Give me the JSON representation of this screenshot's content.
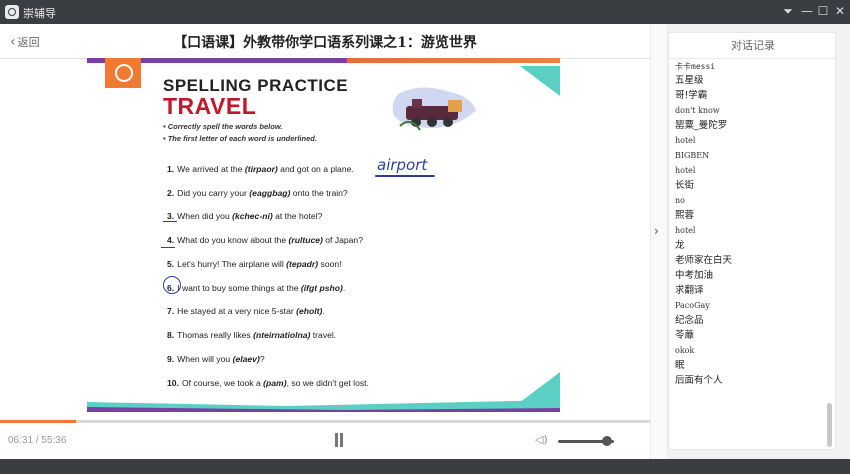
{
  "window": {
    "app_name": "崇辅导",
    "controls": [
      "⏷",
      "—",
      "☐",
      "✕"
    ]
  },
  "header": {
    "back_label": "返回",
    "lesson_title": "【口语课】外教带你学口语系列课之1：游览世界"
  },
  "slide": {
    "heading_line1": "SPELLING PRACTICE",
    "heading_line2": "TRAVEL",
    "notes": [
      "Correctly spell the words below.",
      "The first letter of each word is underlined."
    ],
    "questions": [
      {
        "num": "1.",
        "before": "We arrived at the ",
        "jumble": "(tirpaor)",
        "after": " and got on a plane."
      },
      {
        "num": "2.",
        "before": "Did you carry your ",
        "jumble": "(eaggbag)",
        "after": " onto the train?"
      },
      {
        "num": "3.",
        "before": "When did you ",
        "jumble": "(kchec-ni)",
        "after": " at the hotel?"
      },
      {
        "num": "4.",
        "before": "What do you know about the ",
        "jumble": "(rultuce)",
        "after": " of Japan?"
      },
      {
        "num": "5.",
        "before": "Let's hurry!  The airplane will ",
        "jumble": "(tepadr)",
        "after": " soon!"
      },
      {
        "num": "6.",
        "before": "I want to buy some things at the ",
        "jumble": "(ifgt psho)",
        "after": "."
      },
      {
        "num": "7.",
        "before": "He stayed at a very nice 5-star ",
        "jumble": "(eholt)",
        "after": "."
      },
      {
        "num": "8.",
        "before": "Thomas really likes ",
        "jumble": "(nteirnatiolna)",
        "after": " travel."
      },
      {
        "num": "9.",
        "before": "When will you ",
        "jumble": "(elaev)",
        "after": "?"
      },
      {
        "num": "10.",
        "before": "Of course, we took a ",
        "jumble": "(pam)",
        "after": ", so we didn't get lost."
      }
    ],
    "handwritten_answer": "airport"
  },
  "player": {
    "time": "06:31 / 55:36",
    "progress": 0.117,
    "volume": 0.87
  },
  "chat": {
    "title": "对话记录",
    "entries": [
      {
        "user": "卡卡messi",
        "msg": "五星级"
      },
      {
        "user": "",
        "msg": "哥!学霸"
      },
      {
        "user": "",
        "msg": "don't know",
        "mono": true
      },
      {
        "user": "",
        "msg": "罂粟_曼陀罗"
      },
      {
        "user": "",
        "msg": "hotel",
        "mono": true
      },
      {
        "user": "",
        "msg": "BIGBEN",
        "mono": true
      },
      {
        "user": "",
        "msg": "hotel",
        "mono": true
      },
      {
        "user": "",
        "msg": "长街"
      },
      {
        "user": "",
        "msg": "no",
        "mono": true
      },
      {
        "user": "",
        "msg": "熙蓉"
      },
      {
        "user": "",
        "msg": "hotel",
        "mono": true
      },
      {
        "user": "",
        "msg": "龙"
      },
      {
        "user": "",
        "msg": "老师家在白天"
      },
      {
        "user": "",
        "msg": "中考加油"
      },
      {
        "user": "",
        "msg": "求翻译"
      },
      {
        "user": "",
        "msg": "PacoGay",
        "mono": true
      },
      {
        "user": "",
        "msg": "纪念品"
      },
      {
        "user": "",
        "msg": "苓蘼"
      },
      {
        "user": "",
        "msg": "okok",
        "mono": true
      },
      {
        "user": "",
        "msg": "眠"
      },
      {
        "user": "",
        "msg": "后面有个人"
      }
    ]
  }
}
